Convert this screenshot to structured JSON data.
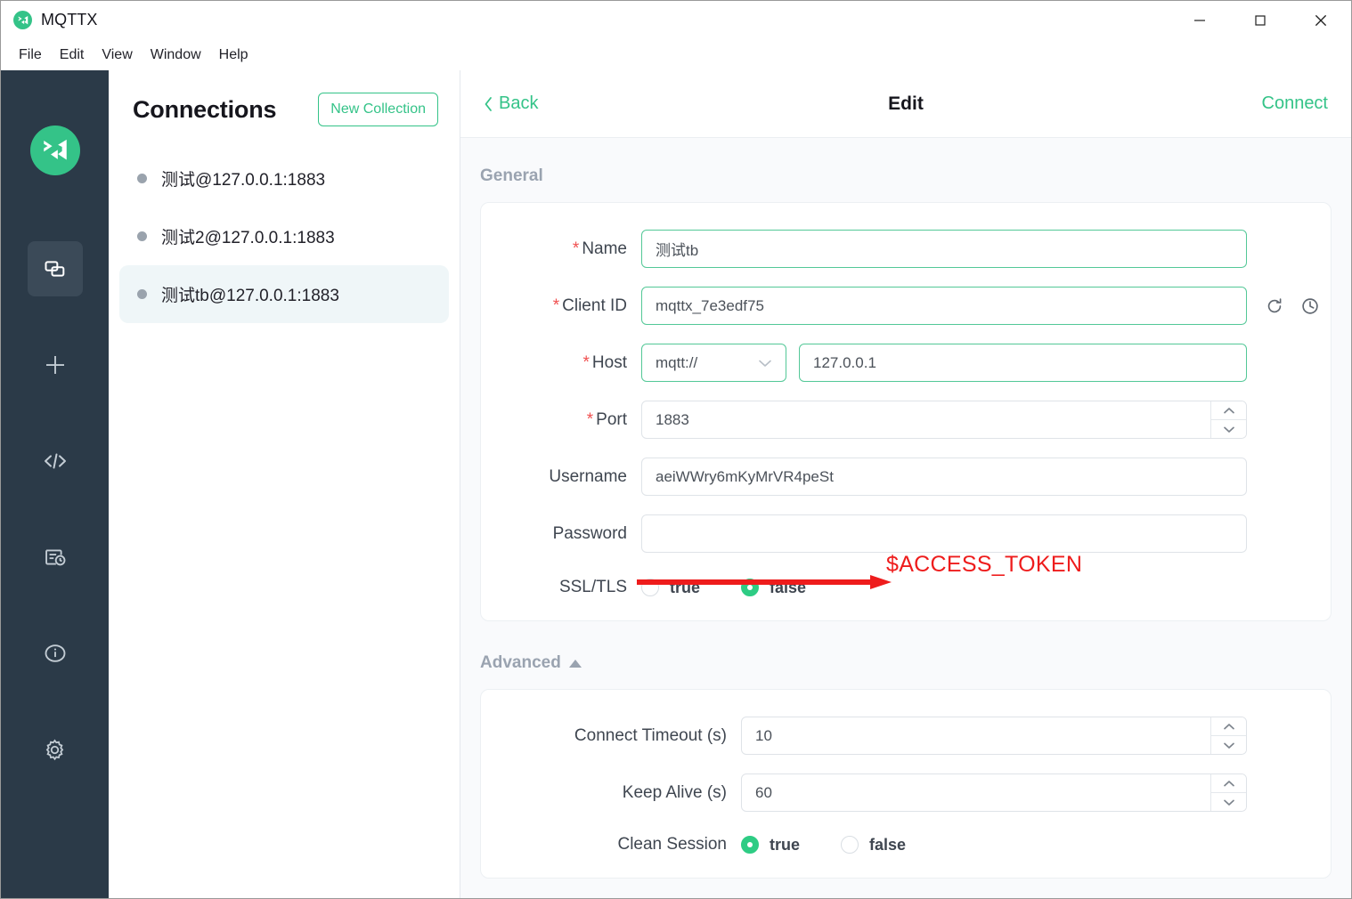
{
  "window": {
    "app_title": "MQTTX",
    "logo_icon": "mqttx-logo-icon",
    "minimize_icon": "minimize-icon",
    "maximize_icon": "maximize-icon",
    "close_icon": "close-icon"
  },
  "menubar": {
    "items": [
      {
        "label": "File"
      },
      {
        "label": "Edit"
      },
      {
        "label": "View"
      },
      {
        "label": "Window"
      },
      {
        "label": "Help"
      }
    ]
  },
  "rail": {
    "items": [
      {
        "icon": "connections-icon",
        "active": true
      },
      {
        "icon": "plus-icon",
        "active": false
      },
      {
        "icon": "code-icon",
        "active": false
      },
      {
        "icon": "log-history-icon",
        "active": false
      },
      {
        "icon": "info-icon",
        "active": false
      },
      {
        "icon": "settings-gear-icon",
        "active": false
      }
    ]
  },
  "connections": {
    "title": "Connections",
    "new_collection_label": "New Collection",
    "items": [
      {
        "label": "测试@127.0.0.1:1883",
        "selected": false
      },
      {
        "label": "测试2@127.0.0.1:1883",
        "selected": false
      },
      {
        "label": "测试tb@127.0.0.1:1883",
        "selected": true
      }
    ]
  },
  "edit": {
    "back_label": "Back",
    "title": "Edit",
    "connect_label": "Connect",
    "general_section": "General",
    "advanced_section": "Advanced",
    "fields": {
      "name_label": "Name",
      "name_value": "测试tb",
      "client_id_label": "Client ID",
      "client_id_value": "mqttx_7e3edf75",
      "refresh_icon": "refresh-icon",
      "history_icon": "clock-history-icon",
      "host_label": "Host",
      "host_protocol": "mqtt://",
      "host_value": "127.0.0.1",
      "port_label": "Port",
      "port_value": "1883",
      "username_label": "Username",
      "username_value": "aeiWWry6mKyMrVR4peSt",
      "password_label": "Password",
      "password_value": "",
      "ssl_label": "SSL/TLS",
      "ssl_true": "true",
      "ssl_false": "false",
      "ssl_selected": "false",
      "connect_timeout_label": "Connect Timeout (s)",
      "connect_timeout_value": "10",
      "keep_alive_label": "Keep Alive (s)",
      "keep_alive_value": "60",
      "clean_session_label": "Clean Session",
      "clean_session_true": "true",
      "clean_session_false": "false",
      "clean_session_selected": "true"
    }
  },
  "annotation": {
    "text": "$ACCESS_TOKEN",
    "color": "#ee1c1c",
    "arrow_icon": "red-arrow-icon"
  },
  "colors": {
    "accent_green": "#34c388",
    "rail_bg": "#2b3a48",
    "panel_bg": "#f9fafc",
    "selected_item": "#eff6f8",
    "required_star": "#f05050"
  }
}
